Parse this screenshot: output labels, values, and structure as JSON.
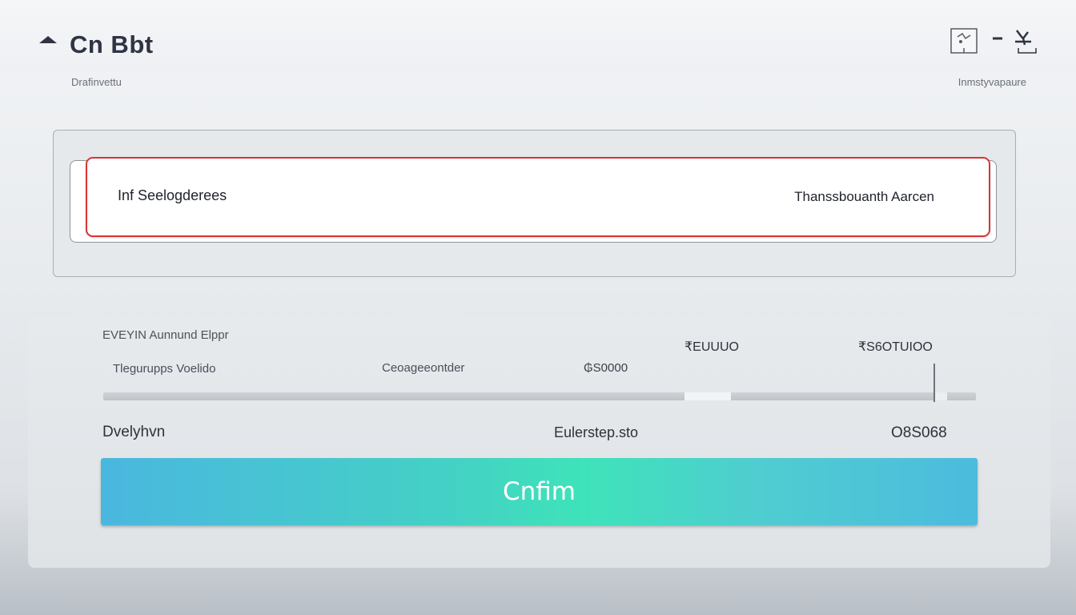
{
  "header": {
    "title": "Cn Bbt",
    "subtitle_left": "Drafinvettu",
    "subtitle_right": "Inmstyvapaure",
    "icons": [
      "logo-icon",
      "image-icon",
      "minimize-icon",
      "close-icon"
    ]
  },
  "selection": {
    "label": "Inf Seelogderees",
    "value": "Thanssbouanth Aarcen"
  },
  "details": {
    "section_label": "EVEYIN Aunnund Elppr",
    "amount_1": "₹EUUUO",
    "amount_2": "₹S6OTUIOO",
    "row": {
      "left": "Tlegurupps Voelido",
      "mid": "Ceoageeontder",
      "value": "₲S0000"
    },
    "slider_level": 0.95,
    "summary": {
      "label": "Dvelyhvn",
      "mid": "Eulerstep.sto",
      "value": "O8S068"
    }
  },
  "confirm_label": "Cnfim",
  "colors": {
    "accent_red": "#d93535",
    "button_gradient_start": "#4ab7df",
    "button_gradient_mid": "#3ee3b9"
  }
}
